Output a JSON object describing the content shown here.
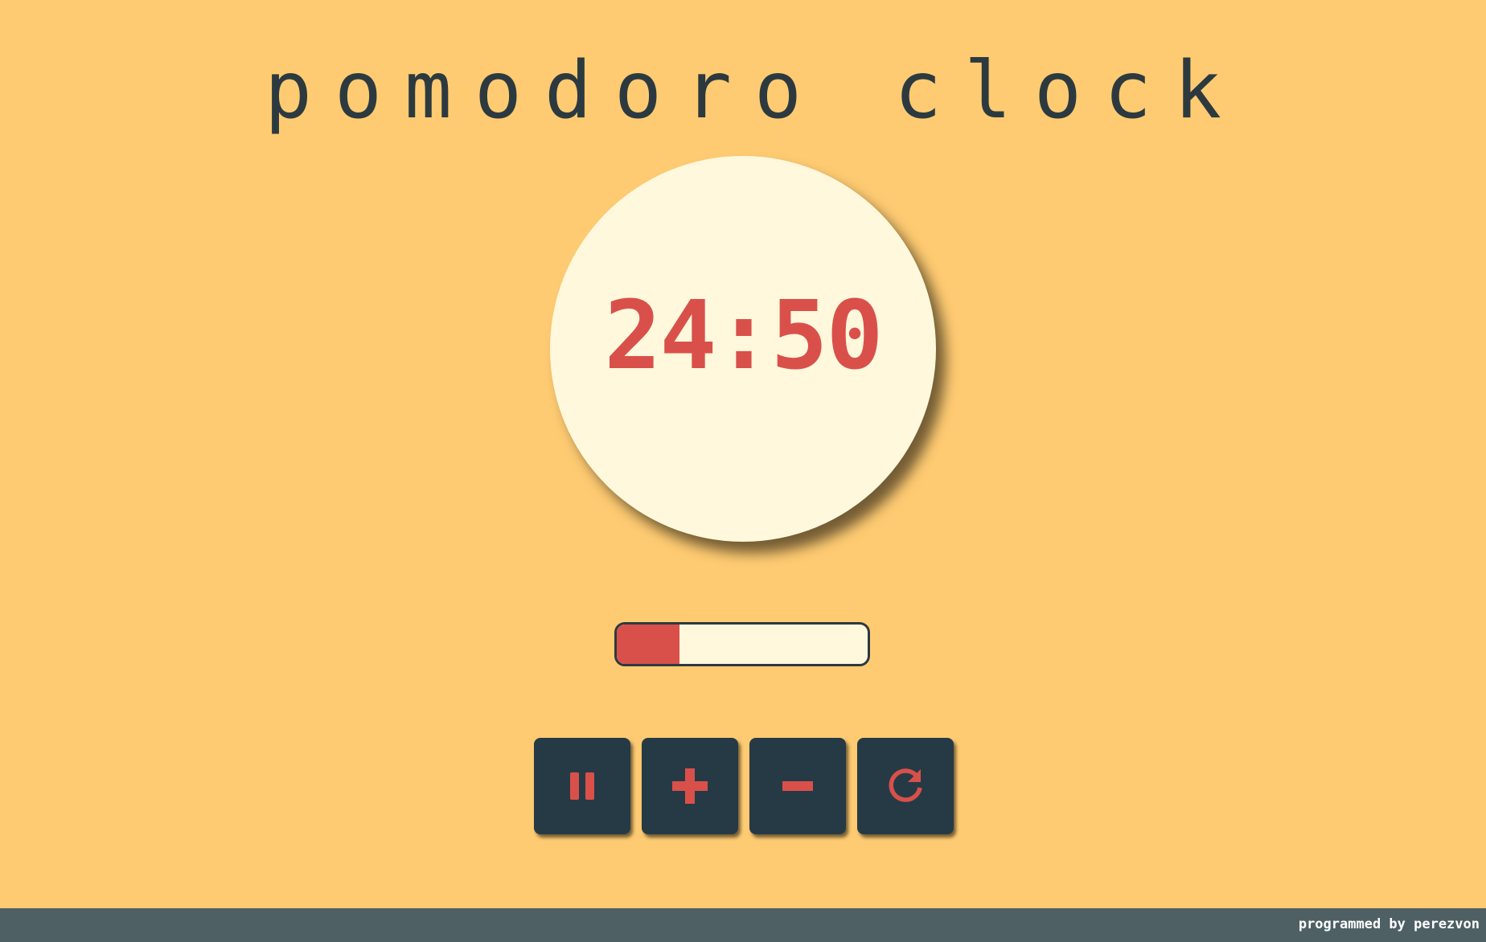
{
  "app": {
    "title": "pomodoro clock"
  },
  "timer": {
    "display": "24:50",
    "progress_fraction": 0.25
  },
  "controls": [
    {
      "name": "pause-button",
      "icon": "pause-icon"
    },
    {
      "name": "increase-button",
      "icon": "plus-icon"
    },
    {
      "name": "decrease-button",
      "icon": "minus-icon"
    },
    {
      "name": "reset-button",
      "icon": "refresh-icon"
    }
  ],
  "footer": {
    "credit": "programmed by perezvon"
  },
  "colors": {
    "background": "#fecb72",
    "accent": "#d9504a",
    "face": "#fff8dc",
    "button": "#263a46",
    "footer": "#4f6065",
    "text": "#2c3a40"
  }
}
